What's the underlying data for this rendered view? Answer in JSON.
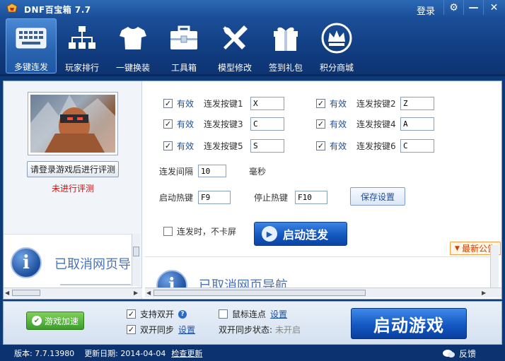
{
  "window": {
    "title": "DNF百宝箱 7.7",
    "login_label": "登录",
    "settings_glyph": "⚙",
    "minimize_glyph": "—",
    "close_glyph": "✕"
  },
  "toolbar": {
    "items": [
      {
        "label": "多键连发",
        "icon": "keyboard-icon",
        "active": true
      },
      {
        "label": "玩家排行",
        "icon": "ranking-tree-icon",
        "active": false
      },
      {
        "label": "一键换装",
        "icon": "tshirt-icon",
        "active": false
      },
      {
        "label": "工具箱",
        "icon": "toolbox-icon",
        "active": false
      },
      {
        "label": "模型修改",
        "icon": "wrench-screwdriver-icon",
        "active": false
      },
      {
        "label": "签到礼包",
        "icon": "gift-icon",
        "active": false
      },
      {
        "label": "积分商城",
        "icon": "crown-shop-icon",
        "active": false
      }
    ]
  },
  "left_panel": {
    "rate_button": "请登录游戏后进行评测",
    "rate_status": "未进行评测",
    "nav_text": "已取消网页导"
  },
  "burst": {
    "valid_label": "有效",
    "keys": [
      {
        "label": "连发按键1",
        "value": "X",
        "checked": true
      },
      {
        "label": "连发按键2",
        "value": "Z",
        "checked": true
      },
      {
        "label": "连发按键3",
        "value": "C",
        "checked": true
      },
      {
        "label": "连发按键4",
        "value": "A",
        "checked": true
      },
      {
        "label": "连发按键5",
        "value": "S",
        "checked": true
      },
      {
        "label": "连发按键6",
        "value": "C",
        "checked": true
      }
    ],
    "interval_label": "连发间隔",
    "interval_value": "10",
    "interval_unit": "毫秒",
    "start_hotkey_label": "启动热键",
    "start_hotkey_value": "F9",
    "stop_hotkey_label": "停止热键",
    "stop_hotkey_value": "F10",
    "save_label": "保存设置",
    "no_lag_label": "连发时，不卡屏",
    "no_lag_checked": false,
    "start_label": "启动连发"
  },
  "notice": {
    "latest_label": "最新公告",
    "nav_text": "已取消网页导航"
  },
  "bottom": {
    "speed_label": "游戏加速",
    "dual_open_label": "支持双开",
    "dual_open_checked": true,
    "dual_sync_label": "双开同步",
    "dual_sync_checked": true,
    "dual_sync_settings": "设置",
    "mouse_click_label": "鼠标连点",
    "mouse_click_checked": false,
    "mouse_click_settings": "设置",
    "sync_status_label": "双开同步状态:",
    "sync_status_value": "未开启",
    "launch_label": "启动游戏"
  },
  "statusbar": {
    "version": "版本: 7.7.13980",
    "update_date": "更新日期: 2014-04-04",
    "check_update": "检查更新",
    "feedback": "反馈"
  }
}
